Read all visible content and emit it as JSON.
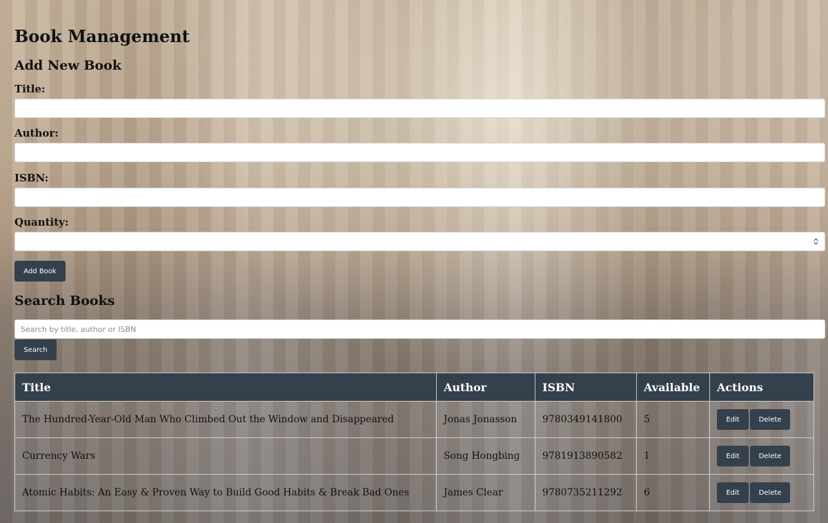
{
  "header": {
    "title": "Book Management"
  },
  "add_form": {
    "heading": "Add New Book",
    "title_label": "Title:",
    "title_value": "",
    "author_label": "Author:",
    "author_value": "",
    "isbn_label": "ISBN:",
    "isbn_value": "",
    "quantity_label": "Quantity:",
    "quantity_value": "",
    "submit_label": "Add Book"
  },
  "search": {
    "heading": "Search Books",
    "placeholder": "Search by title, author or ISBN",
    "value": "",
    "button_label": "Search"
  },
  "table": {
    "columns": [
      "Title",
      "Author",
      "ISBN",
      "Available",
      "Actions"
    ],
    "rows": [
      {
        "title": "The Hundred-Year-Old Man Who Climbed Out the Window and Disappeared",
        "author": "Jonas Jonasson",
        "isbn": "9780349141800",
        "available": "5",
        "edit": "Edit",
        "delete": "Delete"
      },
      {
        "title": "Currency Wars",
        "author": "Song Hongbing",
        "isbn": "9781913890582",
        "available": "1",
        "edit": "Edit",
        "delete": "Delete"
      },
      {
        "title": "Atomic Habits: An Easy & Proven Way to Build Good Habits & Break Bad Ones",
        "author": "James Clear",
        "isbn": "9780735211292",
        "available": "6",
        "edit": "Edit",
        "delete": "Delete"
      }
    ]
  },
  "colors": {
    "accent": "#34404c",
    "field_bg": "#ffffff"
  },
  "icons": {
    "quantity_spinner": "stepper-arrows-icon"
  }
}
